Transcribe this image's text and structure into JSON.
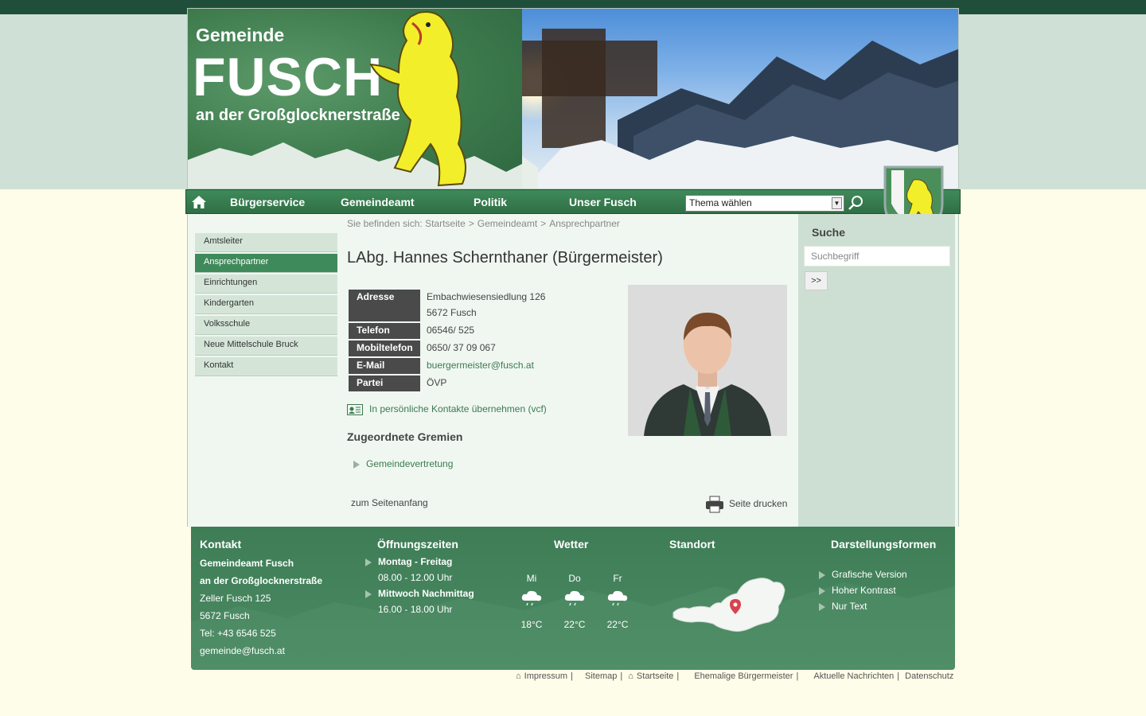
{
  "header": {
    "logo_line1": "Gemeinde",
    "logo_line2": "FUSCH",
    "logo_line3": "an der Großglocknerstraße"
  },
  "nav": {
    "items": [
      "Bürgerservice",
      "Gemeindeamt",
      "Politik",
      "Unser Fusch"
    ],
    "topic_select": "Thema wählen"
  },
  "sidebar": {
    "items": [
      "Amtsleiter",
      "Ansprechpartner",
      "Einrichtungen",
      "Kindergarten",
      "Volksschule",
      "Neue Mittelschule Bruck",
      "Kontakt"
    ],
    "active": "Ansprechpartner"
  },
  "breadcrumb": {
    "prefix": "Sie befinden sich:",
    "items": [
      "Startseite",
      "Gemeindeamt",
      "Ansprechpartner"
    ]
  },
  "person": {
    "title": "LAbg. Hannes Schernthaner (Bürgermeister)",
    "fields": [
      {
        "label": "Adresse",
        "value": "Embachwiesensiedlung 126",
        "value2": "5672 Fusch"
      },
      {
        "label": "Telefon",
        "value": "06546/ 525"
      },
      {
        "label": "Mobiltelefon",
        "value": "0650/ 37 09 067"
      },
      {
        "label": "E-Mail",
        "value": "buergermeister@fusch.at"
      },
      {
        "label": "Partei",
        "value": "ÖVP"
      }
    ],
    "vcf_link": "In persönliche Kontakte übernehmen (vcf)",
    "gremien_title": "Zugeordnete Gremien",
    "gremien": [
      "Gemeindevertretung"
    ]
  },
  "page_actions": {
    "top": "zum Seitenanfang",
    "print": "Seite drucken"
  },
  "search": {
    "title": "Suche",
    "placeholder": "Suchbegriff",
    "button": ">>"
  },
  "footer": {
    "kontakt": {
      "title": "Kontakt",
      "lines": [
        "Gemeindeamt Fusch",
        "an der Großglocknerstraße",
        "Zeller Fusch 125",
        "5672 Fusch",
        "Tel: +43 6546 525",
        "gemeinde@fusch.at"
      ]
    },
    "oeffnungszeiten": {
      "title": "Öffnungszeiten",
      "entries": [
        {
          "day": "Montag - Freitag",
          "time": "08.00 - 12.00 Uhr"
        },
        {
          "day": "Mittwoch Nachmittag",
          "time": "16.00 - 18.00 Uhr"
        }
      ]
    },
    "wetter": {
      "title": "Wetter",
      "days": [
        {
          "day": "Mi",
          "temp": "18°C",
          "icon": "rain-cloud-icon"
        },
        {
          "day": "Do",
          "temp": "22°C",
          "icon": "rain-cloud-icon"
        },
        {
          "day": "Fr",
          "temp": "22°C",
          "icon": "rain-cloud-icon"
        }
      ]
    },
    "standort": {
      "title": "Standort"
    },
    "darstellung": {
      "title": "Darstellungsformen",
      "items": [
        "Grafische Version",
        "Hoher Kontrast",
        "Nur Text"
      ]
    }
  },
  "bottom_links": [
    "Impressum",
    "Sitemap",
    "Startseite",
    "Ehemalige Bürgermeister",
    "Aktuelle Nachrichten",
    "Datenschutz"
  ],
  "colors": {
    "brand_green": "#3f8a5a",
    "dark_green": "#1f4f3a",
    "link_green": "#3b7a4f",
    "label_bg": "#4a4a4a"
  }
}
